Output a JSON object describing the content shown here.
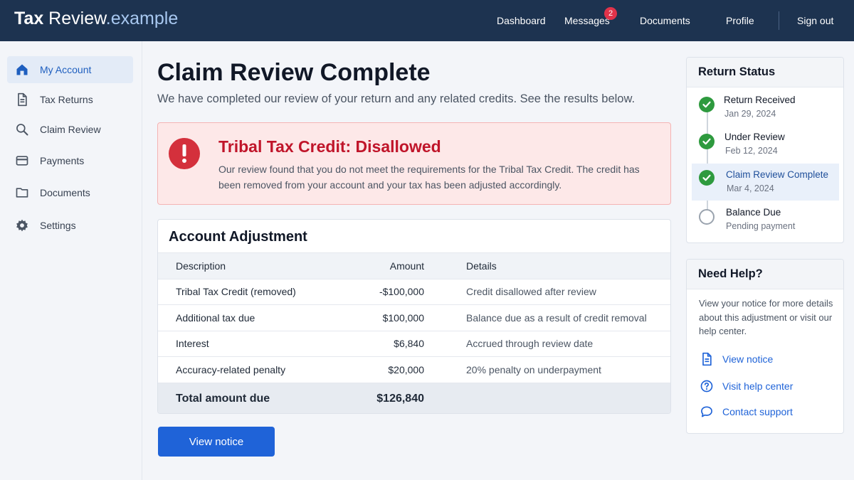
{
  "header": {
    "brand_bold": "Tax",
    "brand_main": " Review",
    "brand_light": ".example",
    "nav": {
      "dashboard": "Dashboard",
      "messages": "Messages",
      "messages_badge": "2",
      "documents": "Documents",
      "profile": "Profile",
      "sign_out": "Sign out"
    }
  },
  "sidebar": {
    "items": [
      {
        "label": "My Account",
        "icon": "home-icon",
        "active": true
      },
      {
        "label": "Tax Returns",
        "icon": "document-icon"
      },
      {
        "label": "Claim Review",
        "icon": "search-icon"
      },
      {
        "label": "Payments",
        "icon": "credit-card-icon"
      },
      {
        "label": "Documents",
        "icon": "folder-icon"
      },
      {
        "label": "Settings",
        "icon": "gear-icon"
      }
    ]
  },
  "main": {
    "title": "Claim Review Complete",
    "subtitle": "We have completed our review of your return and any related credits. See the results below.",
    "alert": {
      "icon": "exclamation-icon",
      "title": "Tribal Tax Credit: Disallowed",
      "body": "Our review found that you do not meet the requirements for the Tribal Tax Credit. The credit has been removed from your account and your tax has been adjusted accordingly."
    },
    "adjustment": {
      "title": "Account Adjustment",
      "columns": [
        "Description",
        "Amount",
        "Details"
      ],
      "rows": [
        {
          "description": "Tribal Tax Credit (removed)",
          "amount": "-$100,000",
          "details": "Credit disallowed after review"
        },
        {
          "description": "Additional tax due",
          "amount": "$100,000",
          "details": "Balance due as a result of credit removal"
        },
        {
          "description": "Interest",
          "amount": "$6,840",
          "details": "Accrued through review date"
        },
        {
          "description": "Accuracy-related penalty",
          "amount": "$20,000",
          "details": "20% penalty on underpayment"
        }
      ],
      "total_label": "Total amount due",
      "total_amount": "$126,840"
    },
    "view_notice_button": "View notice"
  },
  "status_panel": {
    "title": "Return Status",
    "steps": [
      {
        "name": "Return Received",
        "date": "Jan 29, 2024",
        "state": "done"
      },
      {
        "name": "Under Review",
        "date": "Feb 12, 2024",
        "state": "done"
      },
      {
        "name": "Claim Review Complete",
        "date": "Mar 4, 2024",
        "state": "current"
      },
      {
        "name": "Balance Due",
        "date": "Pending payment",
        "state": "pending"
      }
    ]
  },
  "help_panel": {
    "title": "Need Help?",
    "text": "View your notice for more details about this adjustment or visit our help center.",
    "links": [
      {
        "label": "View notice",
        "icon": "document-icon"
      },
      {
        "label": "Visit help center",
        "icon": "question-circle-icon"
      },
      {
        "label": "Contact support",
        "icon": "chat-bubble-icon"
      }
    ]
  },
  "colors": {
    "header_bg": "#1d3350",
    "accent": "#1f63d8",
    "danger": "#c0152a",
    "success": "#2e9a3e"
  }
}
